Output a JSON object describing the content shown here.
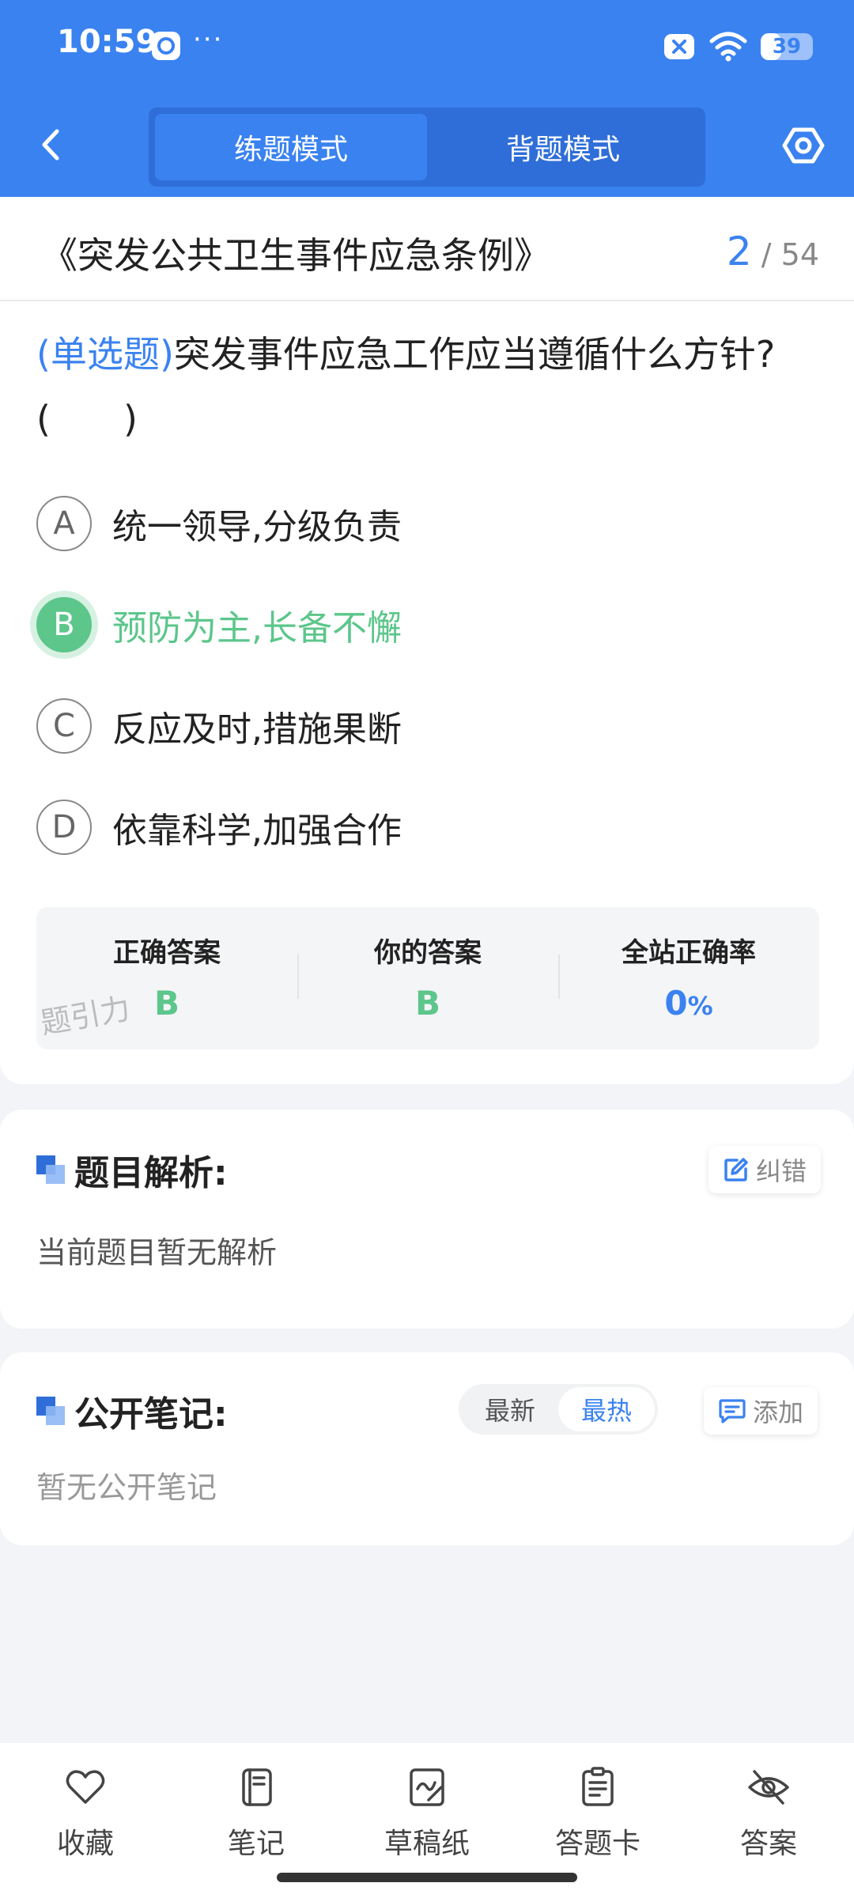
{
  "status": {
    "time": "10:59",
    "dots": "···",
    "battery": "39"
  },
  "header": {
    "tabs": [
      {
        "label": "练题模式",
        "active": true
      },
      {
        "label": "背题模式",
        "active": false
      }
    ]
  },
  "exam": {
    "title": "《突发公共卫生事件应急条例》",
    "current": "2",
    "separator": "/",
    "total": "54"
  },
  "question": {
    "type": "(单选题)",
    "text": "突发事件应急工作应当遵循什么方针?(　　)",
    "options": [
      {
        "letter": "A",
        "text": "统一领导,分级负责",
        "selected": false
      },
      {
        "letter": "B",
        "text": "预防为主,长备不懈",
        "selected": true
      },
      {
        "letter": "C",
        "text": "反应及时,措施果断",
        "selected": false
      },
      {
        "letter": "D",
        "text": "依靠科学,加强合作",
        "selected": false
      }
    ]
  },
  "answer_panel": {
    "correct_label": "正确答案",
    "correct_value": "B",
    "yours_label": "你的答案",
    "yours_value": "B",
    "rate_label": "全站正确率",
    "rate_value": "0",
    "rate_unit": "%",
    "watermark": "题引力"
  },
  "analysis": {
    "title": "题目解析:",
    "report_label": "纠错",
    "empty": "当前题目暂无解析"
  },
  "notes": {
    "title": "公开笔记:",
    "sort": [
      {
        "label": "最新",
        "active": false
      },
      {
        "label": "最热",
        "active": true
      }
    ],
    "add_label": "添加",
    "empty": "暂无公开笔记"
  },
  "bottom_bar": [
    {
      "label": "收藏",
      "icon": "heart-icon"
    },
    {
      "label": "笔记",
      "icon": "notebook-icon"
    },
    {
      "label": "草稿纸",
      "icon": "draft-icon"
    },
    {
      "label": "答题卡",
      "icon": "answer-card-icon"
    },
    {
      "label": "答案",
      "icon": "eye-off-icon"
    }
  ],
  "colors": {
    "primary": "#3a82f0",
    "correct": "#5cc68b",
    "background": "#f2f4f7"
  }
}
